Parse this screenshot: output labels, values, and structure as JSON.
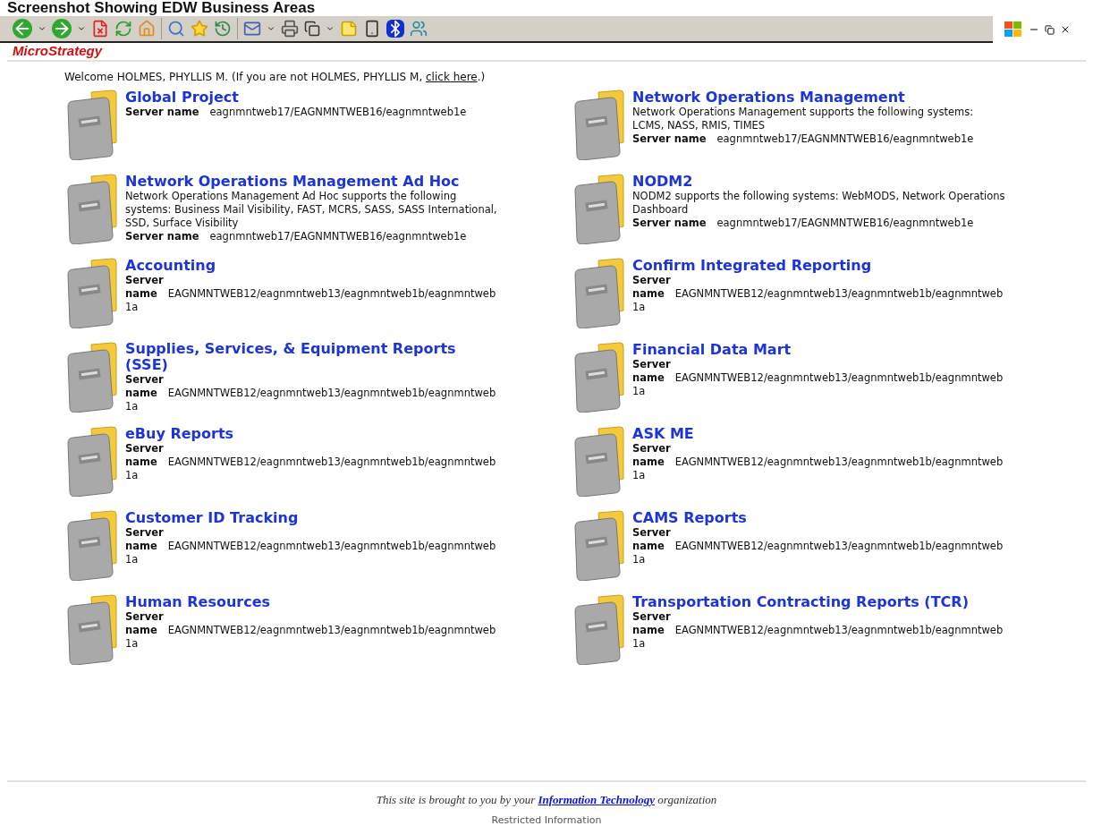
{
  "caption": "Screenshot Showing EDW Business Areas",
  "logo": "MicroStrategy",
  "welcome": {
    "text": "Welcome HOLMES, PHYLLIS M. (If you are not HOLMES, PHYLLIS M, ",
    "link": "click here",
    "after": ".)"
  },
  "areas": [
    {
      "title": "Global Project",
      "server_label": "Server name",
      "server": "eagnmntweb17/EAGNMNTWEB16/eagnmntweb1e"
    },
    {
      "title": "Network Operations Management",
      "description": "Network Operations Management supports the following systems: LCMS, NASS, RMIS, TIMES",
      "server_label": "Server name",
      "server": "eagnmntweb17/EAGNMNTWEB16/eagnmntweb1e"
    },
    {
      "title": "Network Operations Management Ad Hoc",
      "description": "Network Operations Management Ad Hoc supports the following systems: Business Mail Visibility, FAST, MCRS, SASS, SASS International, SSD, Surface Visibility",
      "server_label": "Server name",
      "server": "eagnmntweb17/EAGNMNTWEB16/eagnmntweb1e"
    },
    {
      "title": "NODM2",
      "description": "NODM2 supports the following systems: WebMODS, Network Operations Dashboard",
      "server_label": "Server name",
      "server": "eagnmntweb17/EAGNMNTWEB16/eagnmntweb1e"
    },
    {
      "title": "Accounting",
      "server_label": "Server name",
      "server": "EAGNMNTWEB12/eagnmntweb13/eagnmntweb1b/eagnmntweb1a"
    },
    {
      "title": "Confirm Integrated Reporting",
      "server_label": "Server name",
      "server": "EAGNMNTWEB12/eagnmntweb13/eagnmntweb1b/eagnmntweb1a"
    },
    {
      "title": "Supplies, Services, & Equipment Reports (SSE)",
      "server_label": "Server name",
      "server": "EAGNMNTWEB12/eagnmntweb13/eagnmntweb1b/eagnmntweb1a"
    },
    {
      "title": "Financial Data Mart",
      "server_label": "Server name",
      "server": "EAGNMNTWEB12/eagnmntweb13/eagnmntweb1b/eagnmntweb1a"
    },
    {
      "title": "eBuy Reports",
      "server_label": "Server name",
      "server": "EAGNMNTWEB12/eagnmntweb13/eagnmntweb1b/eagnmntweb1a"
    },
    {
      "title": "ASK ME",
      "server_label": "Server name",
      "server": "EAGNMNTWEB12/eagnmntweb13/eagnmntweb1b/eagnmntweb1a"
    },
    {
      "title": "Customer ID Tracking",
      "server_label": "Server name",
      "server": "EAGNMNTWEB12/eagnmntweb13/eagnmntweb1b/eagnmntweb1a"
    },
    {
      "title": "CAMS Reports",
      "server_label": "Server name",
      "server": "EAGNMNTWEB12/eagnmntweb13/eagnmntweb1b/eagnmntweb1a"
    },
    {
      "title": "Human Resources",
      "server_label": "Server name",
      "server": "EAGNMNTWEB12/eagnmntweb13/eagnmntweb1b/eagnmntweb1a"
    },
    {
      "title": "Transportation Contracting Reports (TCR)",
      "server_label": "Server name",
      "server": "EAGNMNTWEB12/eagnmntweb13/eagnmntweb1b/eagnmntweb1a"
    }
  ],
  "footer": {
    "before": "This site is brought to you by your ",
    "link": "Information Technology",
    "after": " organization"
  },
  "restricted": "Restricted Information"
}
